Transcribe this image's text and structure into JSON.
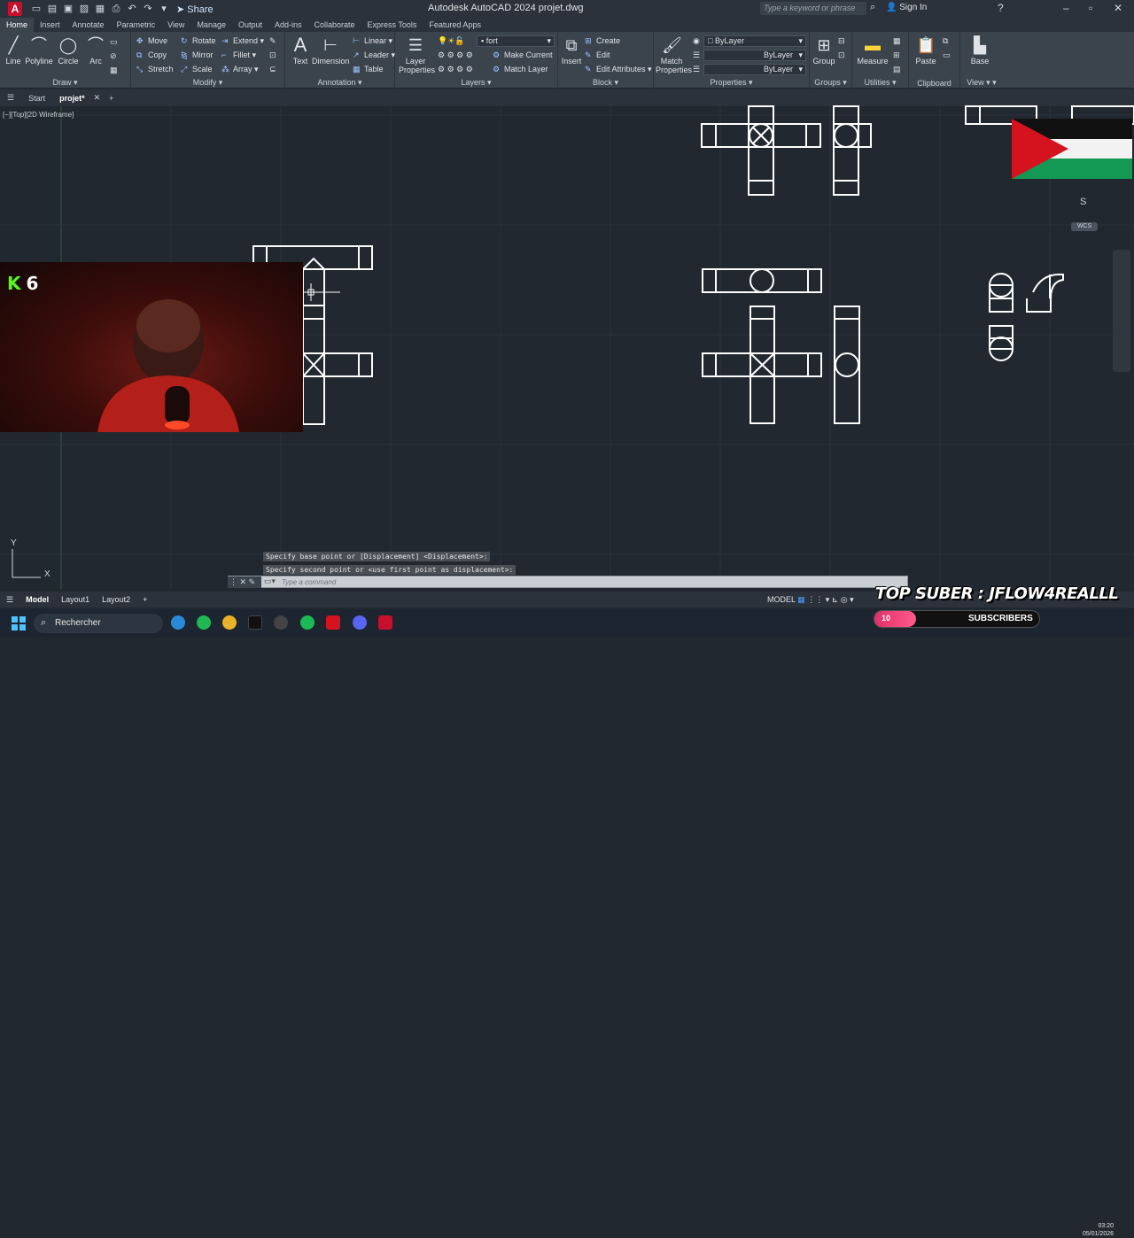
{
  "title_bar": {
    "app_letter": "A",
    "share_label": "Share",
    "window_title": "Autodesk AutoCAD 2024   projet.dwg",
    "search_placeholder": "Type a keyword or phrase",
    "sign_in": "Sign In"
  },
  "ribbon_tabs": [
    "Home",
    "Insert",
    "Annotate",
    "Parametric",
    "View",
    "Manage",
    "Output",
    "Add-ins",
    "Collaborate",
    "Express Tools",
    "Featured Apps"
  ],
  "draw_panel": {
    "title": "Draw",
    "tools": [
      "Line",
      "Polyline",
      "Circle",
      "Arc"
    ]
  },
  "modify_panel": {
    "title": "Modify",
    "tools": [
      "Move",
      "Rotate",
      "Extend",
      "Copy",
      "Mirror",
      "Fillet",
      "Stretch",
      "Scale",
      "Array"
    ]
  },
  "annotation_panel": {
    "title": "Annotation",
    "text": "Text",
    "dimension": "Dimension",
    "linear": "Linear",
    "leader": "Leader",
    "table": "Table"
  },
  "layers_panel": {
    "title": "Layers",
    "layer_properties": "Layer Properties",
    "current_layer": "fort",
    "make_current": "Make Current",
    "match_layer": "Match Layer"
  },
  "block_panel": {
    "title": "Block",
    "insert": "Insert",
    "create": "Create",
    "edit": "Edit",
    "edit_attributes": "Edit Attributes"
  },
  "properties_panel": {
    "title": "Properties",
    "match_properties": "Match Properties",
    "color": "ByLayer",
    "linetype": "ByLayer",
    "lineweight": "ByLayer"
  },
  "groups_panel": {
    "title": "Groups",
    "group": "Group"
  },
  "utilities_panel": {
    "title": "Utilities",
    "measure": "Measure"
  },
  "clipboard_panel": {
    "title": "Clipboard",
    "paste": "Paste"
  },
  "view_panel": {
    "title": "View",
    "base": "Base"
  },
  "doc_tabs": [
    "Start",
    "projet*"
  ],
  "viewport_label": "[−][Top][2D Wireframe]",
  "viewcube": {
    "direction": "S",
    "wcs": "WCS"
  },
  "webcam": {
    "kick_count": "6"
  },
  "command_history": [
    "Specify base point or [Displacement] <Displacement>:",
    "Specify second point or <use first point as displacement>:"
  ],
  "command_prompt": "Type a command",
  "layout_tabs": [
    "Model",
    "Layout1",
    "Layout2"
  ],
  "status_model": "MODEL",
  "overlay": {
    "top_suber": "TOP SUBER : JFLOW4REALLL",
    "subs_count": "10",
    "subs_label": "SUBSCRIBERS",
    "subs_progress": 0.25
  },
  "taskbar": {
    "search": "Rechercher"
  },
  "clock": {
    "time": "03:20",
    "date": "05/01/2026"
  },
  "colors": {
    "accent": "#1f6fd1",
    "bg": "#212830",
    "lines": "#ffffff",
    "flag_red": "#d4131f",
    "flag_green": "#149954"
  }
}
